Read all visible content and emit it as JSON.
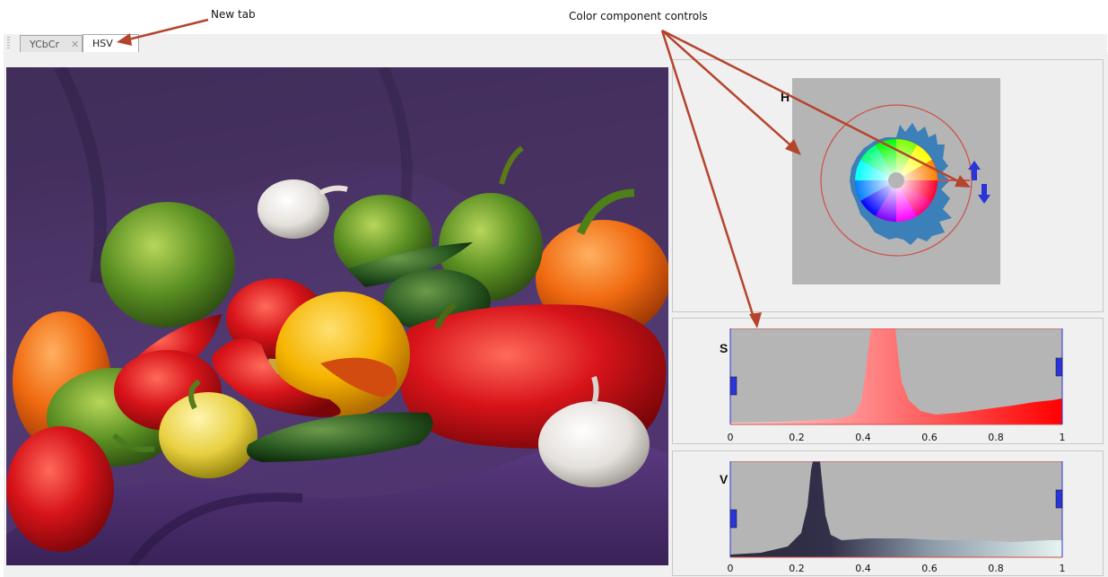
{
  "annotations": {
    "new_tab": "New tab",
    "controls": "Color component controls"
  },
  "tabs": [
    {
      "label": "YCbCr",
      "close": "✕"
    },
    {
      "label": "HSV"
    }
  ],
  "components": {
    "h": {
      "label": "H"
    },
    "s": {
      "label": "S",
      "ticks": [
        "0",
        "0.2",
        "0.4",
        "0.6",
        "0.8",
        "1"
      ]
    },
    "v": {
      "label": "V",
      "ticks": [
        "0",
        "0.2",
        "0.4",
        "0.6",
        "0.8",
        "1"
      ]
    }
  },
  "colors": {
    "annotation_arrow": "#b5442d",
    "plot_bg": "#b5b5b5",
    "handle": "#2a35d8",
    "s_hist_start": "#f5c8c8",
    "s_hist_end": "#ff0000",
    "v_hist_start": "#2a2740",
    "v_hist_end": "#ddf0f0"
  }
}
